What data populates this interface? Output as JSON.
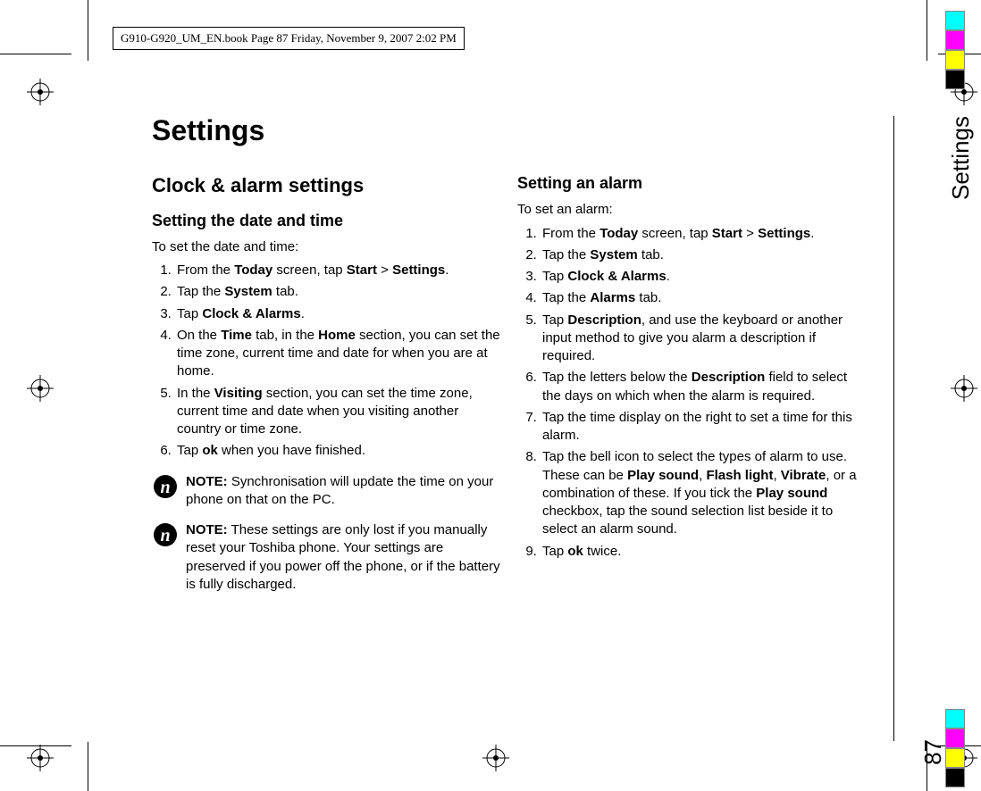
{
  "header_box": "G910-G920_UM_EN.book  Page 87  Friday, November 9, 2007  2:02 PM",
  "title": "Settings",
  "side_label": "Settings",
  "page_number": "87",
  "left": {
    "h2": "Clock & alarm settings",
    "h3": "Setting the date and time",
    "intro": "To set the date and time:",
    "steps": {
      "s1a": "From the ",
      "s1b": "Today",
      "s1c": " screen, tap ",
      "s1d": "Start",
      "s1e": " > ",
      "s1f": "Settings",
      "s1g": ".",
      "s2a": "Tap the ",
      "s2b": "System",
      "s2c": " tab.",
      "s3a": "Tap ",
      "s3b": "Clock & Alarms",
      "s3c": ".",
      "s4a": "On the ",
      "s4b": "Time",
      "s4c": " tab, in the ",
      "s4d": "Home",
      "s4e": " section, you can set the time zone, current time and date for when you are at home.",
      "s5a": "In the ",
      "s5b": "Visiting",
      "s5c": " section, you can set the time zone, current time and date when you visiting another country or time zone.",
      "s6a": "Tap ",
      "s6b": "ok",
      "s6c": " when you have finished."
    },
    "note1_label": "NOTE:",
    "note1_text": " Synchronisation will update the time on your phone on that on the PC.",
    "note2_label": "NOTE:",
    "note2_text": " These settings are only lost if you manually reset your Toshiba phone. Your settings are preserved if you power off the phone, or if the battery is fully discharged."
  },
  "right": {
    "h3": "Setting an alarm",
    "intro": "To set an alarm:",
    "steps": {
      "s1a": "From the ",
      "s1b": "Today",
      "s1c": " screen, tap ",
      "s1d": "Start",
      "s1e": " > ",
      "s1f": "Settings",
      "s1g": ".",
      "s2a": "Tap the ",
      "s2b": "System",
      "s2c": " tab.",
      "s3a": "Tap ",
      "s3b": "Clock & Alarms",
      "s3c": ".",
      "s4a": "Tap the ",
      "s4b": "Alarms",
      "s4c": " tab.",
      "s5a": "Tap ",
      "s5b": "Description",
      "s5c": ", and use the keyboard or another input method to give you alarm a description if required.",
      "s6a": "Tap the letters below the ",
      "s6b": "Description",
      "s6c": " field to select the days on which when the alarm is required.",
      "s7": "Tap the time display on the right to set a time for this alarm.",
      "s8a": "Tap the bell icon to select the types of alarm to use. These can be ",
      "s8b": "Play sound",
      "s8c": ", ",
      "s8d": "Flash light",
      "s8e": ", ",
      "s8f": "Vibrate",
      "s8g": ", or a combination of these. If you tick the ",
      "s8h": "Play sound",
      "s8i": " checkbox, tap the sound selection list beside it to select an alarm sound.",
      "s9a": "Tap ",
      "s9b": "ok",
      "s9c": " twice."
    }
  }
}
